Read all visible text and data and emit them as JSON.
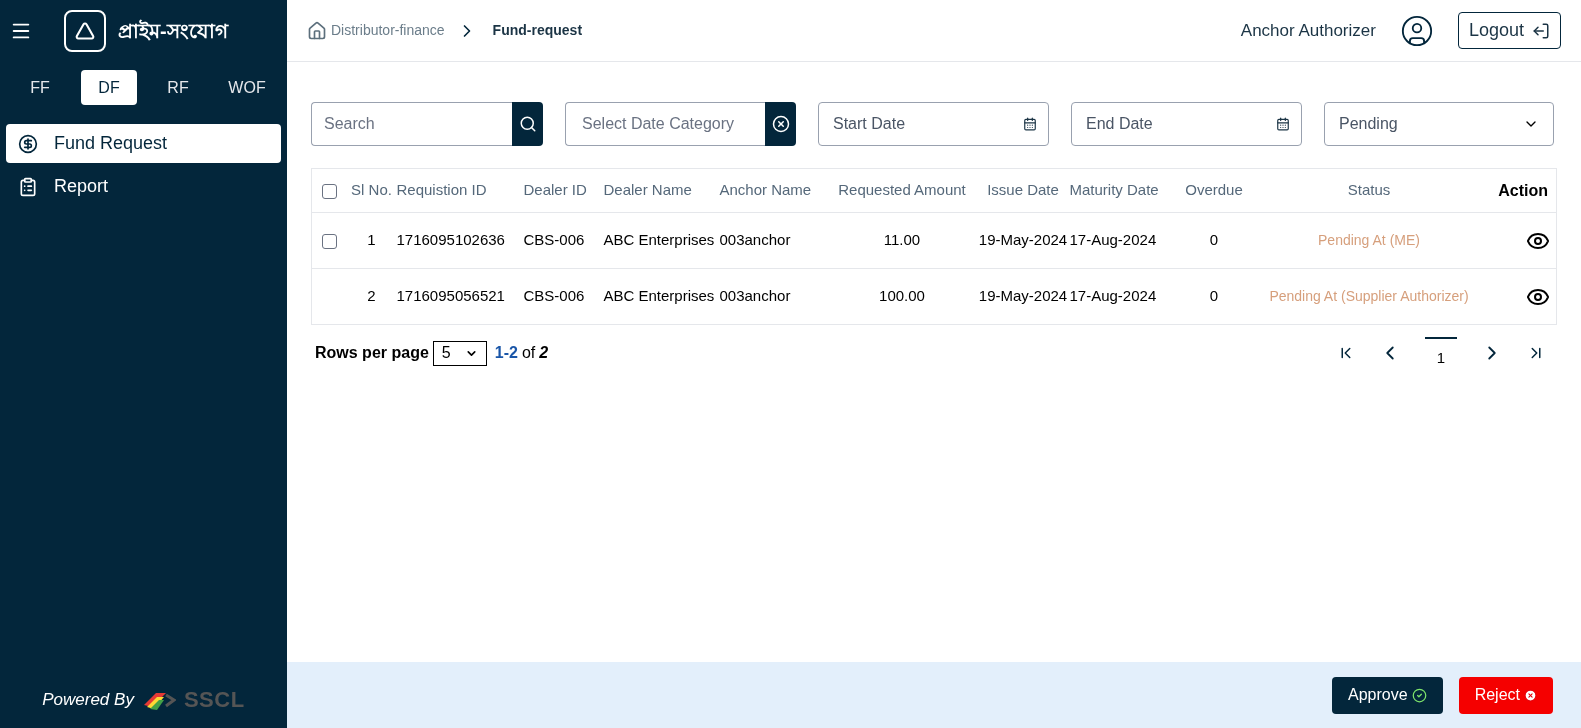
{
  "sidebar": {
    "brand": "প্রাইম-সংযোগ",
    "tabs": [
      {
        "label": "FF",
        "selected": false
      },
      {
        "label": "DF",
        "selected": true
      },
      {
        "label": "RF",
        "selected": false
      },
      {
        "label": "WOF",
        "selected": false
      }
    ],
    "items": [
      {
        "label": "Fund Request",
        "kind": "fund",
        "selected": true
      },
      {
        "label": "Report",
        "kind": "report",
        "selected": false
      }
    ],
    "footer": {
      "powered_by": "Powered By",
      "logo_text": "SSCL"
    }
  },
  "breadcrumb": [
    {
      "label": "Distributor-finance",
      "selected": false
    },
    {
      "label": "Fund-request",
      "selected": true
    }
  ],
  "header": {
    "user": "Anchor Authorizer",
    "logout": "Logout"
  },
  "filters": {
    "search": {
      "placeholder": "Search"
    },
    "date_category": {
      "placeholder": "Select Date Category"
    },
    "start_date": {
      "placeholder": "Start Date"
    },
    "end_date": {
      "placeholder": "End Date"
    },
    "status": {
      "value": "Pending"
    }
  },
  "table": {
    "header_checked": false,
    "columns": [
      "Sl No.",
      "Requistion ID",
      "Dealer ID",
      "Dealer Name",
      "Anchor Name",
      "Requested Amount",
      "Issue Date",
      "Maturity Date",
      "Overdue",
      "Status",
      "Action"
    ],
    "rows": [
      {
        "selectable": true,
        "checked": false,
        "cells": [
          "1",
          "1716095102636",
          "CBS-006",
          "ABC Enterprises",
          "003anchor",
          "11.00",
          "19-May-2024",
          "17-Aug-2024",
          "0",
          "Pending At (ME)"
        ]
      },
      {
        "selectable": false,
        "cells": [
          "2",
          "1716095056521",
          "CBS-006",
          "ABC Enterprises",
          "003anchor",
          "100.00",
          "19-May-2024",
          "17-Aug-2024",
          "0",
          "Pending At (Supplier Authorizer)"
        ]
      }
    ]
  },
  "pagination": {
    "rows_per_page_label": "Rows per page",
    "rows_per_page": "5",
    "range": "1-2",
    "of": "of",
    "total": "2",
    "page": "1"
  },
  "actions": {
    "approve": "Approve",
    "reject": "Reject"
  }
}
